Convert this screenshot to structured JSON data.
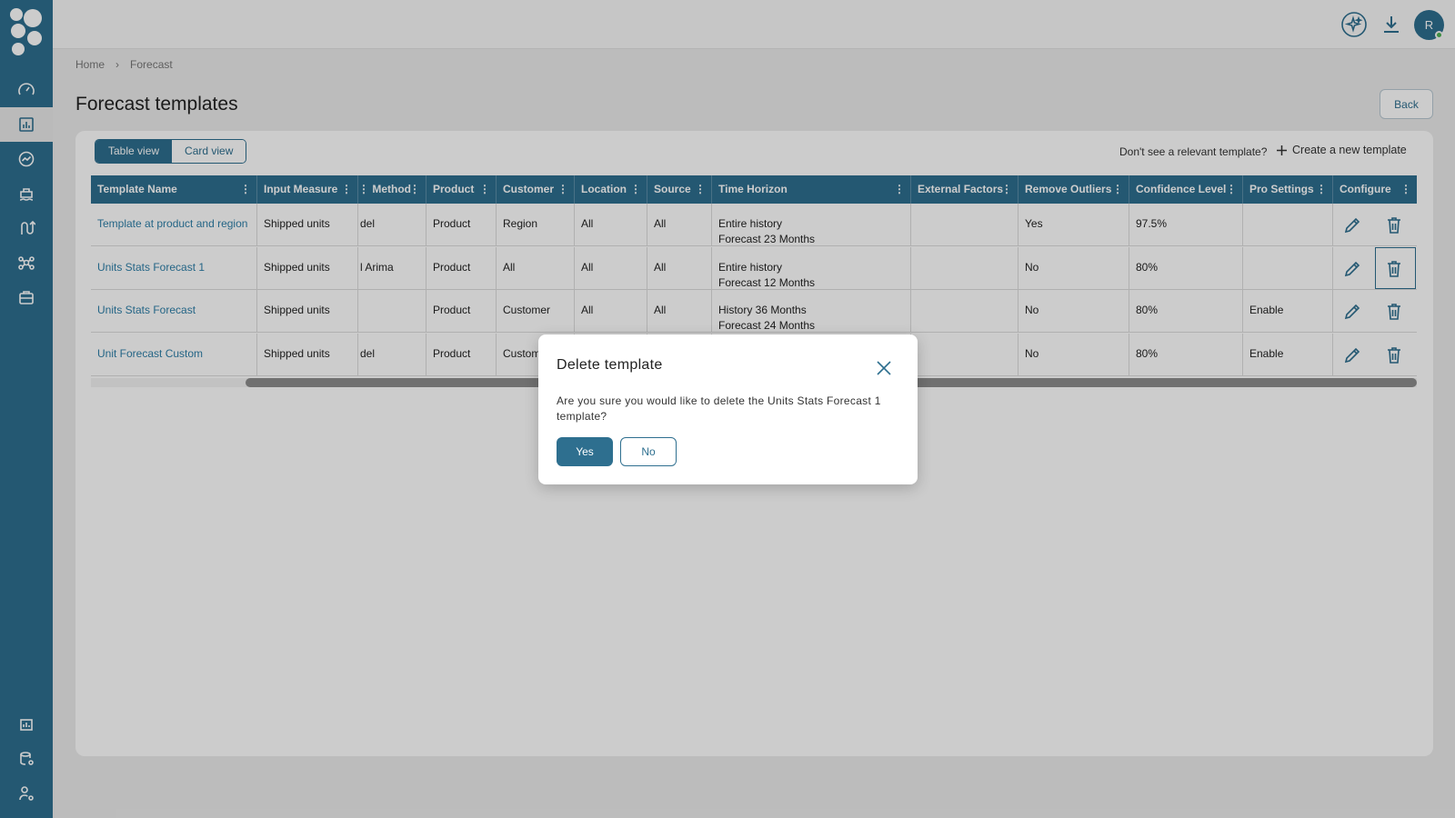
{
  "breadcrumb": {
    "home": "Home",
    "current": "Forecast"
  },
  "page": {
    "title": "Forecast templates",
    "back_label": "Back"
  },
  "view_toggle": {
    "table": "Table view",
    "card": "Card view"
  },
  "prompt_text": "Don't see a relevant template?",
  "create_label": "Create a new template",
  "user": {
    "initial": "R"
  },
  "table": {
    "columns": [
      "Template Name",
      "Input Measure",
      "Method",
      "Product",
      "Customer",
      "Location",
      "Source",
      "Time Horizon",
      "External Factors",
      "Remove Outliers",
      "Confidence Level",
      "Pro Settings",
      "Configure"
    ],
    "rows": [
      {
        "name": "Template at product and region",
        "input": "Shipped units",
        "method": "del",
        "product": "Product",
        "customer": "Region",
        "location": "All",
        "source": "All",
        "horizon1": "Entire history",
        "horizon2": "Forecast 23 Months",
        "external": "",
        "outliers": "Yes",
        "confidence": "97.5%",
        "pro": ""
      },
      {
        "name": "Units Stats Forecast 1",
        "input": "Shipped units",
        "method": "l Arima",
        "product": "Product",
        "customer": "All",
        "location": "All",
        "source": "All",
        "horizon1": "Entire history",
        "horizon2": "Forecast 12 Months",
        "external": "",
        "outliers": "No",
        "confidence": "80%",
        "pro": ""
      },
      {
        "name": "Units Stats Forecast",
        "input": "Shipped units",
        "method": "",
        "product": "Product",
        "customer": "Customer",
        "location": "All",
        "source": "All",
        "horizon1": "History 36 Months",
        "horizon2": "Forecast 24 Months",
        "external": "",
        "outliers": "No",
        "confidence": "80%",
        "pro": "Enable"
      },
      {
        "name": "Unit Forecast Custom",
        "input": "Shipped units",
        "method": "del",
        "product": "Product",
        "customer": "Custom",
        "location": "",
        "source": "",
        "horizon1": "",
        "horizon2": "",
        "external": "",
        "outliers": "No",
        "confidence": "80%",
        "pro": "Enable"
      }
    ]
  },
  "modal": {
    "title": "Delete template",
    "message": "Are you sure you would like to delete the Units Stats Forecast 1 template?",
    "yes": "Yes",
    "no": "No"
  },
  "colors": {
    "primary": "#2e6f8f",
    "link": "#2e7fa8",
    "online": "#4caf50"
  }
}
